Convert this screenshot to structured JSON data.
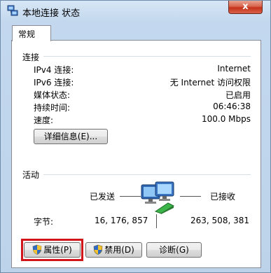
{
  "window": {
    "title": "本地连接 状态",
    "close_glyph": "x"
  },
  "tab": {
    "label": "常规"
  },
  "connection": {
    "group_label": "连接",
    "rows": [
      {
        "label": "IPv4 连接:",
        "value": "Internet"
      },
      {
        "label": "IPv6 连接:",
        "value": "无 Internet 访问权限"
      },
      {
        "label": "媒体状态:",
        "value": "已启用"
      },
      {
        "label": "持续时间:",
        "value": "06:46:38"
      },
      {
        "label": "速度:",
        "value": "100.0 Mbps"
      }
    ],
    "details_button": "详细信息(E)..."
  },
  "activity": {
    "group_label": "活动",
    "sent_label": "已发送",
    "received_label": "已接收",
    "bytes_label": "字节:",
    "bytes_sent": "16, 176, 857",
    "bytes_received": "263, 508, 381"
  },
  "buttons": {
    "properties": "属性(P)",
    "disable": "禁用(D)",
    "diagnose": "诊断(G)"
  },
  "colors": {
    "highlight": "#d0161b"
  }
}
